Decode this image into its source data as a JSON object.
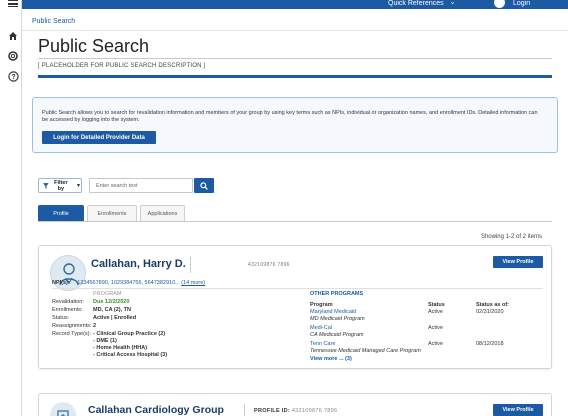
{
  "header": {
    "quick_references": "Quick References",
    "login": "Login",
    "chevron_icon": "chevron-down-icon",
    "user_icon": "user-icon"
  },
  "leftnav": {
    "menu_icon": "menu-icon",
    "home_icon": "home-icon",
    "support_icon": "lifebuoy-icon",
    "help_icon": "help-icon"
  },
  "breadcrumb": "Public Search",
  "page": {
    "title": "Public Search",
    "description": "[ PLACEHOLDER FOR PUBLIC SEARCH DESCRIPTION ]"
  },
  "info": {
    "text": "Public Search allows you to search for revalidation information and members of your group by using key terms such as NPIs, individual or organization names, and enrollment IDs. Detailed information can be accessed by logging into the system.",
    "login_button": "Login for Detailed Provider Data"
  },
  "search": {
    "filter_label": "Filter by",
    "placeholder": "Enter search text"
  },
  "tabs": [
    {
      "label": "Profile",
      "active": true
    },
    {
      "label": "Enrollments",
      "active": false
    },
    {
      "label": "Applications",
      "active": false
    }
  ],
  "results_summary": "Showing 1-2 of 2 items",
  "results": [
    {
      "name": "Callahan, Harry D.",
      "profile_id": "432109876 7896",
      "view_button": "View Profile",
      "npis_label": "NPI(s):",
      "npis_value": "1234567890, 1029384756, 5647382910...",
      "npis_more": "(14 more)",
      "program_heading": "PROGRAM",
      "revalidation_label": "Revalidation:",
      "revalidation_value": "Due 12/2/2020",
      "enrollments_label": "Enrollments:",
      "enrollments_value": "MD, CA (2), TN",
      "status_label": "Status:",
      "status_value": "Active | Enrolled",
      "reassignments_label": "Reassignments:",
      "reassignments_value": "2",
      "record_types_label": "Record Type(s):",
      "record_types": [
        "- Clinical Group Practice (2)",
        "- DME (1)",
        "- Home Health (HHA)",
        "- Critical Access Hospital (3)"
      ],
      "other_programs_heading": "OTHER PROGRAMS",
      "col_program": "Program",
      "col_status": "Status",
      "col_status_as_of": "Status as of:",
      "other_programs": [
        {
          "name": "Maryland Medicaid",
          "sub": "MD Medicaid Program",
          "status": "Active",
          "as_of": "02/31/2020"
        },
        {
          "name": "Medi-Cal",
          "sub": "CA Medicaid Program",
          "status": "Active",
          "as_of": ""
        },
        {
          "name": "Tenn Care",
          "sub": "Tennessee Medicaid Managed Care Program",
          "status": "Active",
          "as_of": "08/12/2018"
        }
      ],
      "view_more": "View more ... (3)"
    },
    {
      "name": "Callahan Cardiology Group",
      "profile_id_label": "PROFILE ID:",
      "profile_id": "432109876 7896",
      "view_button": "View Profile"
    }
  ]
}
